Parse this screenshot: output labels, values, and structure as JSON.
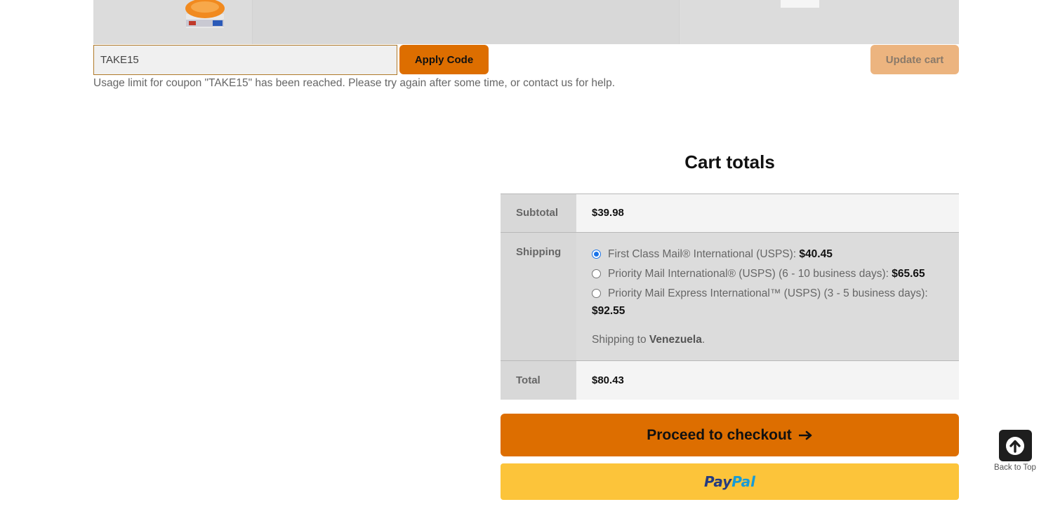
{
  "cart": {
    "thumb_alt": "product-thumbnail"
  },
  "coupon": {
    "value": "TAKE15",
    "apply_label": "Apply Code",
    "update_label": "Update cart",
    "error": "Usage limit for coupon \"TAKE15\" has been reached. Please try again after some time, or contact us for help."
  },
  "totals": {
    "title": "Cart totals",
    "subtotal_label": "Subtotal",
    "subtotal_value": "$39.98",
    "shipping_label": "Shipping",
    "shipping_options": [
      {
        "label": "First Class Mail® International (USPS): ",
        "price": "$40.45",
        "selected": true
      },
      {
        "label": "Priority Mail International® (USPS) (6 - 10 business days): ",
        "price": "$65.65",
        "selected": false
      },
      {
        "label": "Priority Mail Express International™ (USPS) (3 - 5 business days): ",
        "price": "$92.55",
        "selected": false
      }
    ],
    "shipping_dest_prefix": "Shipping to ",
    "shipping_dest_country": "Venezuela",
    "shipping_dest_suffix": ".",
    "total_label": "Total",
    "total_value": "$80.43"
  },
  "actions": {
    "checkout_label": "Proceed to checkout",
    "checkout_icon": "arrow-right-icon",
    "paypal_part1": "Pay",
    "paypal_part2": "Pal"
  },
  "back_to_top": {
    "label": "Back to Top",
    "icon": "arrow-up-circle-icon"
  },
  "colors": {
    "accent": "#dd6e00",
    "accent_light": "#ecb47f",
    "paypal_yellow": "#fcc43a",
    "paypal_dark": "#253b80",
    "paypal_light": "#179bd7"
  }
}
